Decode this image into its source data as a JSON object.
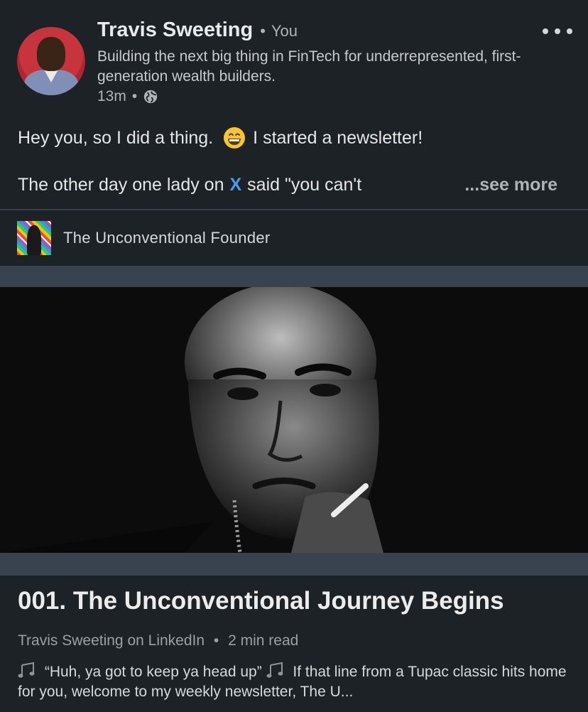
{
  "post": {
    "author_name": "Travis Sweeting",
    "author_separator": "•",
    "author_degree": "You",
    "headline": "Building the next big thing in FinTech for underrepresented, first-generation wealth builders.",
    "timestamp": "13m",
    "meta_separator": "•",
    "visibility_icon": "globe-icon",
    "text_line1_before": "Hey you, so I did a thing.",
    "emoji": "grinning-face-icon",
    "text_line1_after": "I started a newsletter!",
    "text_line2_before": "The other day one lady on",
    "text_line2_mention": "X",
    "text_line2_after": "said \"you can't",
    "see_more_label": "...see more"
  },
  "newsletter": {
    "name": "The Unconventional Founder"
  },
  "article": {
    "title": "001. The Unconventional Journey Begins",
    "source": "Travis Sweeting on LinkedIn",
    "meta_separator": "•",
    "read_time": "2 min read",
    "snippet_part1": "“Huh, ya got to keep ya head up”",
    "snippet_part2": "If that line from a Tupac classic hits home for you, welcome to my weekly newsletter, The U..."
  },
  "colors": {
    "background": "#1d2226",
    "link_blue": "#4c9bf0",
    "cover_frame": "#38434f"
  }
}
